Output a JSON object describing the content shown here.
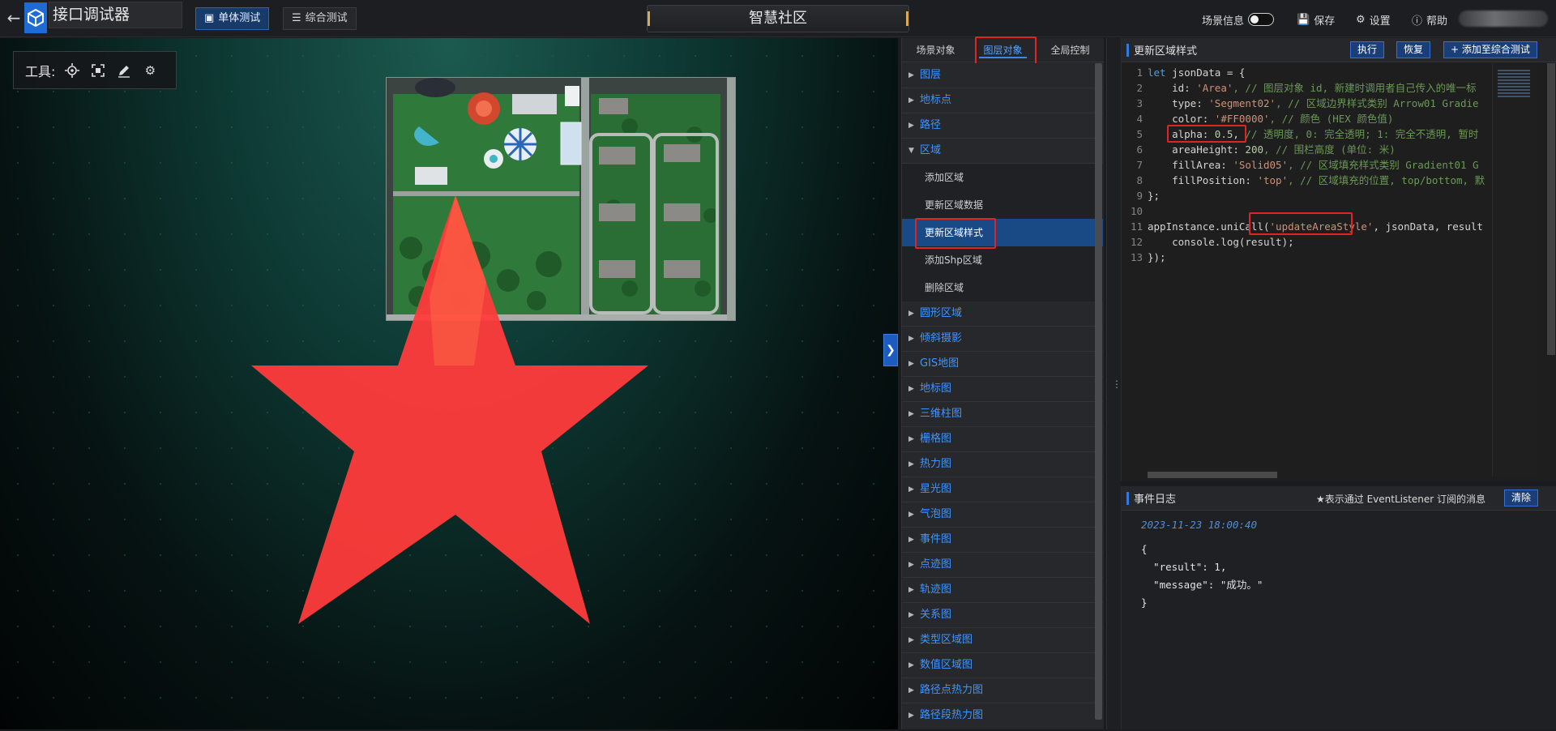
{
  "topbar": {
    "app_title": "接口调试器",
    "tabs": [
      {
        "label": "单体测试",
        "active": true
      },
      {
        "label": "综合测试",
        "active": false
      }
    ],
    "scene_title": "智慧社区",
    "scene_info_label": "场景信息",
    "save_label": "保存",
    "settings_label": "设置",
    "help_label": "帮助"
  },
  "viewport": {
    "tools_label": "工具:",
    "tool_icons": [
      "locate-icon",
      "screenshot-icon",
      "pen-icon",
      "gears-icon"
    ],
    "overlay_color": "#FF0000",
    "overlay_alpha": 0.5
  },
  "menu": {
    "tabs": [
      {
        "label": "场景对象",
        "active": false
      },
      {
        "label": "图层对象",
        "active": true
      },
      {
        "label": "全局控制",
        "active": false
      }
    ],
    "items_before": [
      "图层",
      "地标点",
      "路径"
    ],
    "expanded_group": "区域",
    "sub_items": [
      "添加区域",
      "更新区域数据",
      "更新区域样式",
      "添加Shp区域",
      "删除区域"
    ],
    "active_sub_item": "更新区域样式",
    "items_after": [
      "圆形区域",
      "倾斜摄影",
      "GIS地图",
      "地标图",
      "三维柱图",
      "栅格图",
      "热力图",
      "星光图",
      "气泡图",
      "事件图",
      "点迹图",
      "轨迹图",
      "关系图",
      "类型区域图",
      "数值区域图",
      "路径点热力图",
      "路径段热力图"
    ]
  },
  "code_panel": {
    "title": "更新区域样式",
    "run_label": "执行",
    "reset_label": "恢复",
    "add_label": "添加至综合测试",
    "lines": {
      "l1_kw": "let",
      "l1_rest": " jsonData = {",
      "l2_key": "    id: ",
      "l2_val": "'Area'",
      "l2_cm": ", // 图层对象 id, 新建时调用者自己传入的唯一标",
      "l3_key": "    type: ",
      "l3_val": "'Segment02'",
      "l3_cm": ", // 区域边界样式类别 Arrow01 Gradie",
      "l4_key": "    color: ",
      "l4_val": "'#FF0000'",
      "l4_cm": ", // 颜色 (HEX 颜色值)",
      "l5_key": "    alpha: ",
      "l5_val": "0.5",
      "l5_sep": ",",
      "l5_cm": " // 透明度, 0: 完全透明; 1: 完全不透明, 暂时",
      "l6_key": "    areaHeight: ",
      "l6_val": "200",
      "l6_cm": ", // 围栏高度 (单位: 米)",
      "l7_key": "    fillArea: ",
      "l7_val": "'Solid05'",
      "l7_cm": ", // 区域填充样式类别 Gradient01 G",
      "l8_key": "    fillPosition: ",
      "l8_val": "'top'",
      "l8_cm": ", // 区域填充的位置, top/bottom, 默",
      "l9": "};",
      "l10": "",
      "l11_a": "appInstance.uniCall(",
      "l11_str": "'updateAreaStyle'",
      "l11_b": ", jsonData, result",
      "l12": "    console.log(result);",
      "l13": "});"
    }
  },
  "log_panel": {
    "title": "事件日志",
    "hint": "★表示通过 EventListener 订阅的消息",
    "clear_label": "清除",
    "timestamp": "2023-11-23 18:00:40",
    "lines": [
      "{",
      "  \"result\": 1,",
      "  \"message\": \"成功。\"",
      "}"
    ]
  }
}
